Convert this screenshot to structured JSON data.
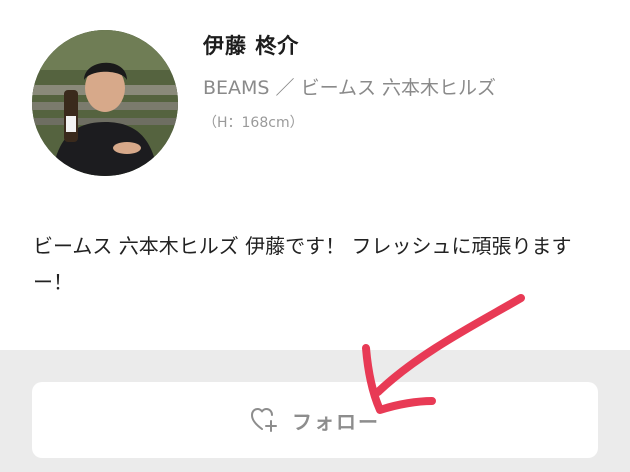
{
  "profile": {
    "name": "伊藤 柊介",
    "shop": "BEAMS ／ ビームス 六本木ヒルズ",
    "height": "（H：168cm）",
    "bio": "ビームス 六本木ヒルズ 伊藤です！ フレッシュに頑張りますー！"
  },
  "follow_button": {
    "label": "フォロー",
    "icon": "heart-plus-icon"
  },
  "colors": {
    "annotation_arrow": "#e83a55",
    "footer_bg": "#ebebeb",
    "button_text": "#8d8d8d"
  }
}
